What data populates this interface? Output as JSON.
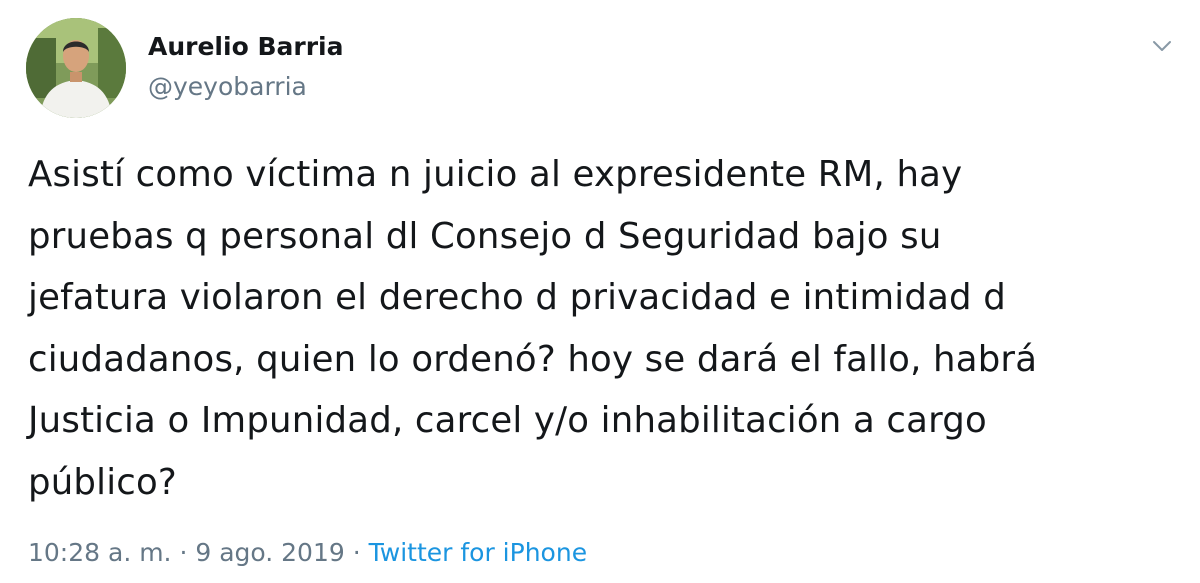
{
  "author": {
    "name": "Aurelio Barria",
    "handle": "@yeyobarria"
  },
  "tweet": {
    "lines": [
      "Asistí como víctima n juicio al expresidente RM, hay",
      "pruebas q personal dl Consejo d Seguridad bajo su",
      "jefatura violaron el derecho d privacidad e intimidad d",
      "ciudadanos, quien lo ordenó? hoy se dará el fallo, habrá",
      "Justicia o Impunidad, carcel y/o inhabilitación a cargo",
      "público?"
    ]
  },
  "meta": {
    "time": "10:28 a. m.",
    "sep1": " · ",
    "date": "9 ago. 2019",
    "sep2": " · ",
    "source": "Twitter for iPhone"
  },
  "icons": {
    "menu": "chevron-down-icon",
    "avatar": "profile-photo"
  },
  "colors": {
    "text": "#14171a",
    "secondary": "#657786",
    "link": "#1b95e0"
  }
}
